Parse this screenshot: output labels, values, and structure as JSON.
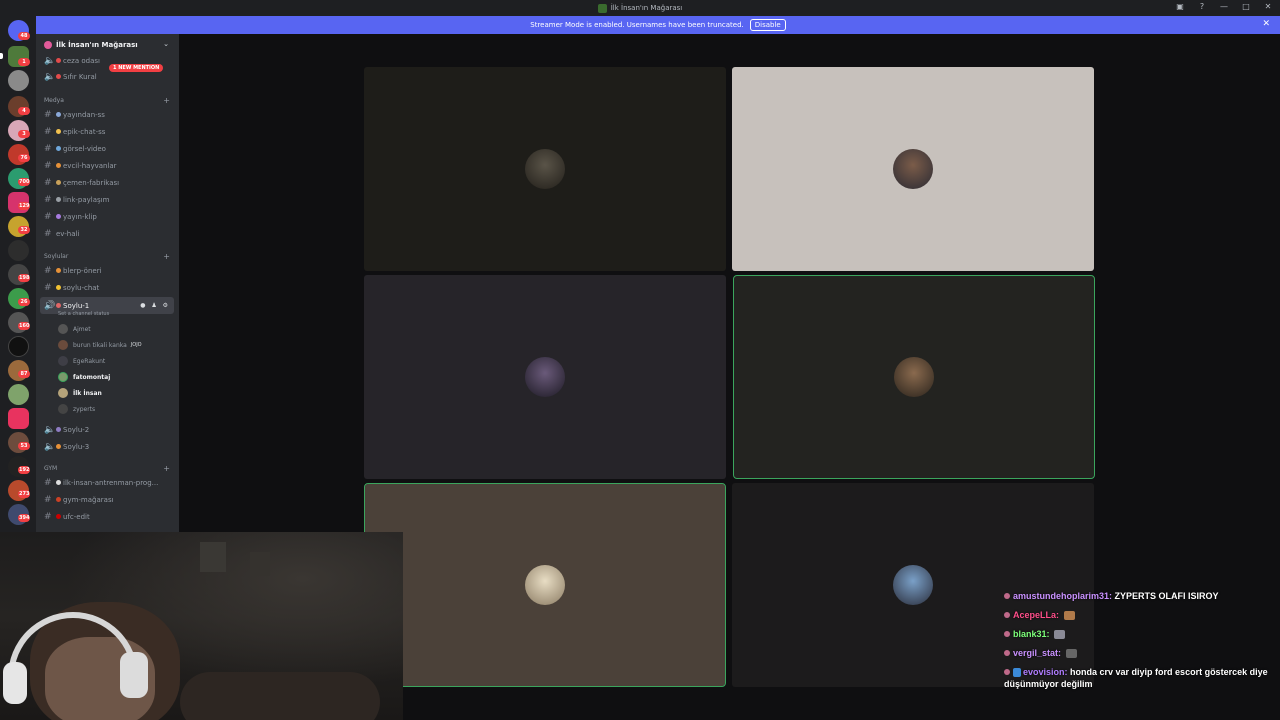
{
  "window": {
    "title": "İlk İnsan'ın Mağarası",
    "minimize": "—",
    "maximize": "□",
    "close": "✕"
  },
  "banner": {
    "text": "Streamer Mode is enabled. Usernames have been truncated.",
    "disable_label": "Disable",
    "close": "✕"
  },
  "server_rail": {
    "badges": [
      "48",
      "1",
      "3",
      "4",
      "3",
      "76",
      "700",
      "129",
      "32",
      "198",
      "26",
      "160",
      "87",
      "53",
      "192",
      "273",
      "394"
    ]
  },
  "sidebar": {
    "server_name": "İlk İnsan'ın Mağarası",
    "new_mention": "1 NEW MENTION",
    "top_channels": [
      "ceza odası",
      "Sıfır Kural"
    ],
    "categories": [
      {
        "name": "Medya",
        "channels": [
          "yayından-ss",
          "epik-chat-ss",
          "görsel-video",
          "evcil-hayvanlar",
          "çemen-fabrikası",
          "link-paylaşım",
          "yayın-klip",
          "ev-hali"
        ]
      },
      {
        "name": "Soylular",
        "channels": [
          "blerp-öneri",
          "soylu-chat"
        ]
      }
    ],
    "voice_active": {
      "name": "Soylu-1",
      "status": "Set a channel status",
      "users": [
        {
          "name": "Ajmet",
          "tag": ""
        },
        {
          "name": "burun tikali kanka",
          "tag": "JOJO"
        },
        {
          "name": "EgeRakunt",
          "tag": ""
        },
        {
          "name": "fatomontaj",
          "tag": ""
        },
        {
          "name": "İlk İnsan",
          "tag": ""
        },
        {
          "name": "zyperts",
          "tag": ""
        }
      ]
    },
    "other_voice": [
      "Soylu-2",
      "Soylu-3"
    ],
    "gym": {
      "name": "GYM",
      "channels": [
        "ilk-insan-antrenman-prog...",
        "gym-mağarası",
        "ufc-edit"
      ]
    }
  },
  "chat": [
    {
      "user": "amustundehoplarim31:",
      "text": "ZYPERTS OLAFI ISIROY",
      "color": "#c991ff"
    },
    {
      "user": "AcepeLLa:",
      "text": "",
      "color": "#ff4f8b"
    },
    {
      "user": "blank31:",
      "text": "",
      "color": "#7dff7a"
    },
    {
      "user": "vergil_stat:",
      "text": "",
      "color": "#c991ff"
    },
    {
      "user": "evovision:",
      "text": "honda crv var diyip ford escort göstercek diye düşünmüyor değilim",
      "color": "#b07dff"
    }
  ],
  "colors": {
    "blurple": "#5865f2",
    "speaking": "#3ba55d",
    "mention": "#f23f43"
  }
}
